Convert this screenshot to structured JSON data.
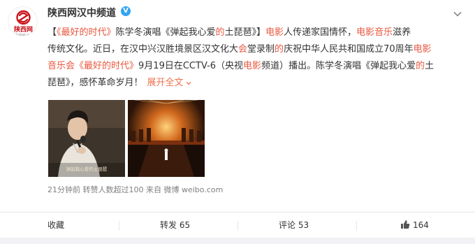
{
  "account": {
    "name": "陕西网汉中频道",
    "verified_badge": "V",
    "avatar_logo_text": "陕西网",
    "avatar_sub_text": "shaanxi.com"
  },
  "post": {
    "lines": [
      [
        {
          "t": "【",
          "c": "plain"
        },
        {
          "t": "《最好的时代》",
          "c": "red"
        },
        {
          "t": "陈学冬演唱《弹起我心爱",
          "c": "plain"
        },
        {
          "t": "的",
          "c": "red"
        },
        {
          "t": "土琵琶》】",
          "c": "plain"
        },
        {
          "t": "电影",
          "c": "red"
        },
        {
          "t": "人传递家国情怀，",
          "c": "plain"
        },
        {
          "t": "电影音乐",
          "c": "red"
        },
        {
          "t": "滋养",
          "c": "plain"
        }
      ],
      [
        {
          "t": "传统文化。近日，在汉中兴汉胜境景区汉文化大",
          "c": "plain"
        },
        {
          "t": "会",
          "c": "red"
        },
        {
          "t": "堂录制",
          "c": "plain"
        },
        {
          "t": "的",
          "c": "red"
        },
        {
          "t": "庆祝中华人民共和国成立70周年",
          "c": "plain"
        },
        {
          "t": "电影",
          "c": "red"
        }
      ],
      [
        {
          "t": "音乐会",
          "c": "red"
        },
        {
          "t": "《最好的时代》",
          "c": "red"
        },
        {
          "t": "9月19日在CCTV-6（央视",
          "c": "plain"
        },
        {
          "t": "电影",
          "c": "red"
        },
        {
          "t": "频道）播出。陈学冬演唱《弹起我心爱",
          "c": "plain"
        },
        {
          "t": "的",
          "c": "red"
        },
        {
          "t": "土",
          "c": "plain"
        }
      ],
      [
        {
          "t": "琵琶》，感怀革命岁月！",
          "c": "plain"
        }
      ]
    ],
    "expand_label": "展开全文",
    "photo1_caption": "弹起我心爱的土琵琶",
    "meta": "21分钟前 转赞人数超过100 来自 微博 weibo.com"
  },
  "actions": {
    "favorite": "收藏",
    "repost": "转发 65",
    "comment": "评论 53",
    "like_count": "164"
  },
  "icons": {
    "dropdown": "chevron-down-icon",
    "expand": "chevron-down-icon",
    "like": "thumbs-up-icon",
    "verified": "verified-icon"
  },
  "colors": {
    "accent": "#eb7350",
    "highlight": "#e9573f",
    "badge": "#32a4f2",
    "meta": "#808080"
  }
}
